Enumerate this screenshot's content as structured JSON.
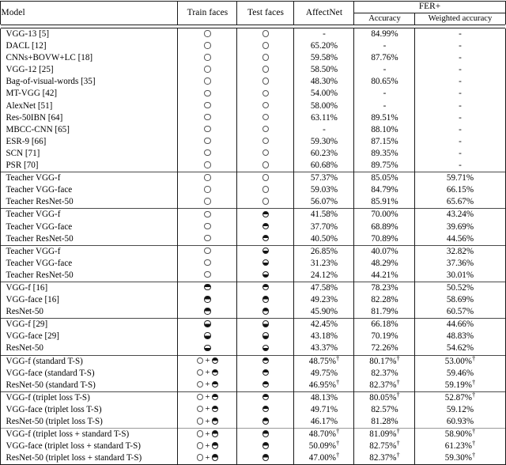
{
  "table": {
    "headers": {
      "model": "Model",
      "train_faces": "Train faces",
      "test_faces": "Test faces",
      "affectnet": "AffectNet",
      "ferplus": "FER+",
      "accuracy": "Accuracy",
      "weighted_accuracy": "Weighted accuracy"
    },
    "symbols": {
      "open": "open-circle",
      "tophalf": "top-half-filled-circle",
      "bottomhalf": "bottom-half-filled-circle",
      "plus": "+",
      "dagger": "†",
      "empty": "-"
    },
    "groups": [
      {
        "id": "published-baselines",
        "rows": [
          {
            "model": "VGG-13 [5]",
            "train": [
              "open"
            ],
            "test": [
              "open"
            ],
            "affectnet": "-",
            "accuracy": "84.99%",
            "weighted": "-"
          },
          {
            "model": "DACL [12]",
            "train": [
              "open"
            ],
            "test": [
              "open"
            ],
            "affectnet": "65.20%",
            "accuracy": "-",
            "weighted": "-"
          },
          {
            "model": "CNNs+BOVW+LC [18]",
            "train": [
              "open"
            ],
            "test": [
              "open"
            ],
            "affectnet": "59.58%",
            "accuracy": "87.76%",
            "weighted": "-"
          },
          {
            "model": "VGG-12 [25]",
            "train": [
              "open"
            ],
            "test": [
              "open"
            ],
            "affectnet": "58.50%",
            "accuracy": "-",
            "weighted": "-"
          },
          {
            "model": "Bag-of-visual-words [35]",
            "train": [
              "open"
            ],
            "test": [
              "open"
            ],
            "affectnet": "48.30%",
            "accuracy": "80.65%",
            "weighted": "-"
          },
          {
            "model": "MT-VGG [42]",
            "train": [
              "open"
            ],
            "test": [
              "open"
            ],
            "affectnet": "54.00%",
            "accuracy": "-",
            "weighted": "-"
          },
          {
            "model": "AlexNet [51]",
            "train": [
              "open"
            ],
            "test": [
              "open"
            ],
            "affectnet": "58.00%",
            "accuracy": "-",
            "weighted": "-"
          },
          {
            "model": "Res-50IBN [64]",
            "train": [
              "open"
            ],
            "test": [
              "open"
            ],
            "affectnet": "63.11%",
            "accuracy": "89.51%",
            "weighted": "-"
          },
          {
            "model": "MBCC-CNN [65]",
            "train": [
              "open"
            ],
            "test": [
              "open"
            ],
            "affectnet": "-",
            "accuracy": "88.10%",
            "weighted": "-"
          },
          {
            "model": "ESR-9 [66]",
            "train": [
              "open"
            ],
            "test": [
              "open"
            ],
            "affectnet": "59.30%",
            "accuracy": "87.15%",
            "weighted": "-"
          },
          {
            "model": "SCN [71]",
            "train": [
              "open"
            ],
            "test": [
              "open"
            ],
            "affectnet": "60.23%",
            "accuracy": "89.35%",
            "weighted": "-"
          },
          {
            "model": "PSR [70]",
            "train": [
              "open"
            ],
            "test": [
              "open"
            ],
            "affectnet": "60.68%",
            "accuracy": "89.75%",
            "weighted": "-"
          }
        ]
      },
      {
        "id": "teachers-faces",
        "rows": [
          {
            "model": "Teacher VGG-f",
            "train": [
              "open"
            ],
            "test": [
              "open"
            ],
            "affectnet": "57.37%",
            "accuracy": "85.05%",
            "weighted": "59.71%"
          },
          {
            "model": "Teacher VGG-face",
            "train": [
              "open"
            ],
            "test": [
              "open"
            ],
            "affectnet": "59.03%",
            "accuracy": "84.79%",
            "weighted": "66.15%"
          },
          {
            "model": "Teacher ResNet-50",
            "train": [
              "open"
            ],
            "test": [
              "open"
            ],
            "affectnet": "56.07%",
            "accuracy": "85.91%",
            "weighted": "65.67%"
          }
        ]
      },
      {
        "id": "teachers-tophalf-test",
        "rows": [
          {
            "model": "Teacher VGG-f",
            "train": [
              "open"
            ],
            "test": [
              "tophalf"
            ],
            "affectnet": "41.58%",
            "accuracy": "70.00%",
            "weighted": "43.24%"
          },
          {
            "model": "Teacher VGG-face",
            "train": [
              "open"
            ],
            "test": [
              "tophalf"
            ],
            "affectnet": "37.70%",
            "accuracy": "68.89%",
            "weighted": "39.69%"
          },
          {
            "model": "Teacher ResNet-50",
            "train": [
              "open"
            ],
            "test": [
              "tophalf"
            ],
            "affectnet": "40.50%",
            "accuracy": "70.89%",
            "weighted": "44.56%"
          }
        ]
      },
      {
        "id": "teachers-bottomhalf-test",
        "rows": [
          {
            "model": "Teacher VGG-f",
            "train": [
              "open"
            ],
            "test": [
              "bottomhalf"
            ],
            "affectnet": "26.85%",
            "accuracy": "40.07%",
            "weighted": "32.82%"
          },
          {
            "model": "Teacher VGG-face",
            "train": [
              "open"
            ],
            "test": [
              "bottomhalf"
            ],
            "affectnet": "31.23%",
            "accuracy": "48.29%",
            "weighted": "37.36%"
          },
          {
            "model": "Teacher ResNet-50",
            "train": [
              "open"
            ],
            "test": [
              "bottomhalf"
            ],
            "affectnet": "24.12%",
            "accuracy": "44.21%",
            "weighted": "30.01%"
          }
        ]
      },
      {
        "id": "students-16",
        "rows": [
          {
            "model": "VGG-f [16]",
            "train": [
              "tophalf"
            ],
            "test": [
              "tophalf"
            ],
            "affectnet": "47.58%",
            "accuracy": "78.23%",
            "weighted": "50.52%"
          },
          {
            "model": "VGG-face [16]",
            "train": [
              "tophalf"
            ],
            "test": [
              "tophalf"
            ],
            "affectnet": "49.23%",
            "accuracy": "82.28%",
            "weighted": "58.69%"
          },
          {
            "model": "ResNet-50",
            "train": [
              "tophalf"
            ],
            "test": [
              "tophalf"
            ],
            "affectnet": "45.90%",
            "accuracy": "81.79%",
            "weighted": "60.57%"
          }
        ]
      },
      {
        "id": "students-29",
        "rows": [
          {
            "model": "VGG-f [29]",
            "train": [
              "bottomhalf"
            ],
            "test": [
              "bottomhalf"
            ],
            "affectnet": "42.45%",
            "accuracy": "66.18%",
            "weighted": "44.66%"
          },
          {
            "model": "VGG-face [29]",
            "train": [
              "bottomhalf"
            ],
            "test": [
              "bottomhalf"
            ],
            "affectnet": "43.18%",
            "accuracy": "70.19%",
            "weighted": "48.83%"
          },
          {
            "model": "ResNet-50",
            "train": [
              "bottomhalf"
            ],
            "test": [
              "bottomhalf"
            ],
            "affectnet": "43.37%",
            "accuracy": "72.26%",
            "weighted": "54.62%"
          }
        ]
      },
      {
        "id": "standard-ts",
        "rows": [
          {
            "model": "VGG-f (standard T-S)",
            "train": [
              "open",
              "plus",
              "tophalf"
            ],
            "test": [
              "tophalf"
            ],
            "affectnet": "48.75%",
            "affectnet_dagger": true,
            "accuracy": "80.17%",
            "accuracy_dagger": true,
            "weighted": "53.00%",
            "weighted_dagger": true
          },
          {
            "model": "VGG-face (standard T-S)",
            "train": [
              "open",
              "plus",
              "tophalf"
            ],
            "test": [
              "tophalf"
            ],
            "affectnet": "49.75%",
            "accuracy": "82.37%",
            "weighted": "59.46%"
          },
          {
            "model": "ResNet-50 (standard T-S)",
            "train": [
              "open",
              "plus",
              "tophalf"
            ],
            "test": [
              "tophalf"
            ],
            "affectnet": "46.95%",
            "affectnet_dagger": true,
            "accuracy": "82.37%",
            "accuracy_dagger": true,
            "weighted": "59.19%",
            "weighted_dagger": true
          }
        ]
      },
      {
        "id": "triplet-ts",
        "rows": [
          {
            "model": "VGG-f (triplet loss T-S)",
            "train": [
              "open",
              "plus",
              "tophalf"
            ],
            "test": [
              "tophalf"
            ],
            "affectnet": "48.13%",
            "accuracy": "80.05%",
            "accuracy_dagger": true,
            "weighted": "52.87%",
            "weighted_dagger": true
          },
          {
            "model": "VGG-face (triplet loss T-S)",
            "train": [
              "open",
              "plus",
              "tophalf"
            ],
            "test": [
              "tophalf"
            ],
            "affectnet": "49.71%",
            "accuracy": "82.57%",
            "weighted": "59.12%"
          },
          {
            "model": "ResNet-50 (triplet loss T-S)",
            "train": [
              "open",
              "plus",
              "tophalf"
            ],
            "test": [
              "tophalf"
            ],
            "affectnet": "46.17%",
            "accuracy": "81.28%",
            "weighted": "60.93%"
          }
        ]
      },
      {
        "id": "triplet-standard-ts",
        "rows": [
          {
            "model": "VGG-f (triplet loss + standard T-S)",
            "train": [
              "open",
              "plus",
              "tophalf"
            ],
            "test": [
              "tophalf"
            ],
            "affectnet": "48.70%",
            "affectnet_dagger": true,
            "accuracy": "81.09%",
            "accuracy_dagger": true,
            "weighted": "58.90%",
            "weighted_dagger": true
          },
          {
            "model": "VGG-face (triplet loss + standard T-S)",
            "train": [
              "open",
              "plus",
              "tophalf"
            ],
            "test": [
              "tophalf"
            ],
            "affectnet": "50.09%",
            "affectnet_dagger": true,
            "accuracy": "82.75%",
            "accuracy_dagger": true,
            "weighted": "61.23%",
            "weighted_dagger": true
          },
          {
            "model": "ResNet-50 (triplet loss + standard T-S)",
            "train": [
              "open",
              "plus",
              "tophalf"
            ],
            "test": [
              "tophalf"
            ],
            "affectnet": "47.00%",
            "affectnet_dagger": true,
            "accuracy": "82.37%",
            "accuracy_dagger": true,
            "weighted": "59.30%",
            "weighted_dagger": true
          }
        ]
      }
    ]
  }
}
